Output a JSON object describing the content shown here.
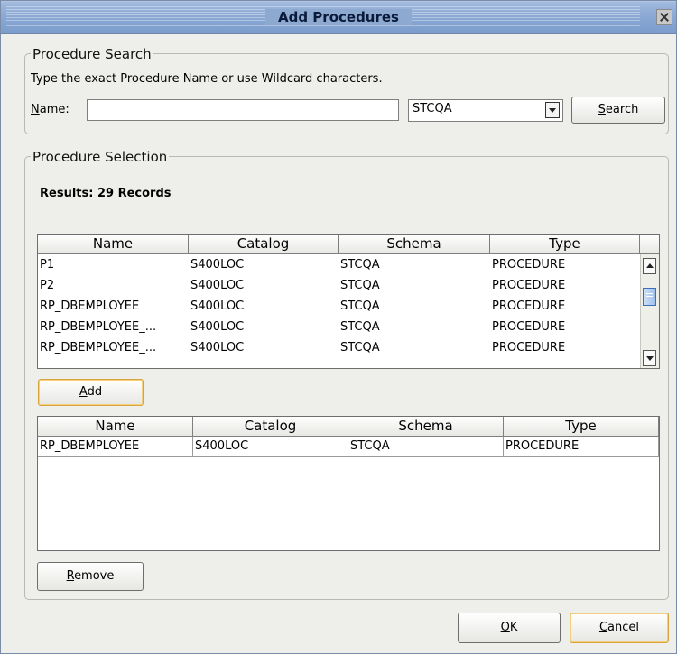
{
  "window": {
    "title": "Add Procedures",
    "close_icon": "close-icon"
  },
  "procedure_search": {
    "group_label": "Procedure Search",
    "hint": "Type the exact Procedure Name or use Wildcard characters.",
    "name_label_prefix": "N",
    "name_label_rest": "ame:",
    "name_value": "",
    "schema_selected": "STCQA",
    "search_button_prefix": "S",
    "search_button_rest": "earch"
  },
  "procedure_selection": {
    "group_label": "Procedure Selection",
    "results_text": "Results:  29 Records",
    "columns": [
      "Name",
      "Catalog",
      "Schema",
      "Type"
    ],
    "results_rows": [
      {
        "name": "P1",
        "catalog": "S400LOC",
        "schema": "STCQA",
        "type": "PROCEDURE"
      },
      {
        "name": "P2",
        "catalog": "S400LOC",
        "schema": "STCQA",
        "type": "PROCEDURE"
      },
      {
        "name": "RP_DBEMPLOYEE",
        "catalog": "S400LOC",
        "schema": "STCQA",
        "type": "PROCEDURE"
      },
      {
        "name": "RP_DBEMPLOYEE_...",
        "catalog": "S400LOC",
        "schema": "STCQA",
        "type": "PROCEDURE"
      },
      {
        "name": "RP_DBEMPLOYEE_...",
        "catalog": "S400LOC",
        "schema": "STCQA",
        "type": "PROCEDURE"
      }
    ],
    "add_button_prefix": "A",
    "add_button_rest": "dd",
    "selected_columns": [
      "Name",
      "Catalog",
      "Schema",
      "Type"
    ],
    "selected_rows": [
      {
        "name": "RP_DBEMPLOYEE",
        "catalog": "S400LOC",
        "schema": "STCQA",
        "type": "PROCEDURE"
      }
    ],
    "remove_button_prefix": "R",
    "remove_button_rest": "emove"
  },
  "footer": {
    "ok_prefix": "O",
    "ok_rest": "K",
    "cancel_prefix": "C",
    "cancel_rest": "ancel"
  }
}
